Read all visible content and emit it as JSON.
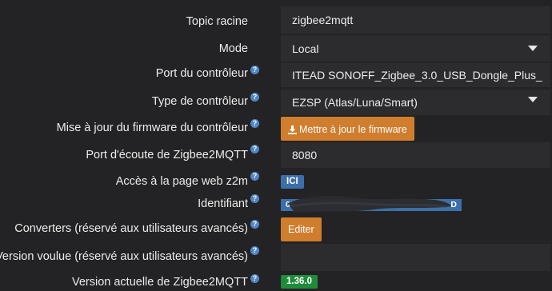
{
  "rows": {
    "topic": {
      "label": "Topic racine",
      "value": "zigbee2mqtt"
    },
    "mode": {
      "label": "Mode",
      "value": "Local"
    },
    "port": {
      "label": "Port du contrôleur",
      "value": "ITEAD SONOFF_Zigbee_3.0_USB_Dongle_Plus_"
    },
    "type": {
      "label": "Type de contrôleur",
      "value": "EZSP (Atlas/Luna/Smart)"
    },
    "firmware": {
      "label": "Mise à jour du firmware du contrôleur",
      "button": "Mettre à jour le firmware"
    },
    "listen_port": {
      "label": "Port d'écoute de Zigbee2MQTT",
      "value": "8080"
    },
    "web": {
      "label": "Accès à la page web z2m",
      "badge": "ICI"
    },
    "identifiant": {
      "label": "Identifiant",
      "badge_start": "0E",
      "badge_end": "D"
    },
    "converters": {
      "label": "Converters (réservé aux utilisateurs avancés)",
      "button": "Editer"
    },
    "wanted_version": {
      "label": "Version voulue (réservé aux utilisateurs avancés)",
      "value": ""
    },
    "current_version": {
      "label": "Version actuelle de Zigbee2MQTT",
      "badge": "1.36.0"
    }
  },
  "help_glyph": "?",
  "icons": {
    "help": "question-circle-icon",
    "download": "download-icon",
    "dropdown": "caret-down-icon"
  },
  "colors": {
    "background": "#232325",
    "field": "#2c2c2f",
    "help_icon": "#4f86c6",
    "orange_button": "#d07d2e",
    "blue_badge": "#3c6faa",
    "green_badge": "#1f8c3a"
  }
}
